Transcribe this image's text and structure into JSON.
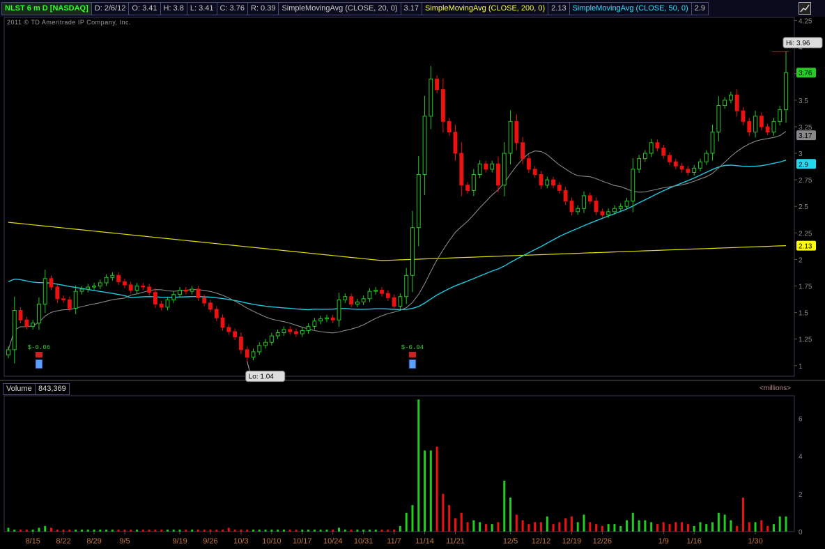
{
  "header": {
    "symbol": "NLST 6 m D [NASDAQ]",
    "date": "D: 2/6/12",
    "open": "O: 3.41",
    "high": "H: 3.8",
    "low": "L: 3.41",
    "close": "C: 3.76",
    "range": "R: 0.39",
    "sma20_label": "SimpleMovingAvg (CLOSE, 20, 0)",
    "sma20_value": "3.17",
    "sma200_label": "SimpleMovingAvg (CLOSE, 200, 0)",
    "sma200_value": "2.13",
    "sma50_label": "SimpleMovingAvg (CLOSE, 50, 0)",
    "sma50_value": "2.9"
  },
  "copyright": "2011 © TD Ameritrade IP Company, Inc.",
  "volume_panel": {
    "label": "Volume",
    "value": "843,369",
    "unit": "<millions>"
  },
  "colors": {
    "up": "#22cc22",
    "down": "#ee1111",
    "sma20": "#888888",
    "sma50": "#1ec8e0",
    "sma200": "#e0e000",
    "hiline": "#bb2222"
  },
  "chart_data": {
    "type": "candlestick",
    "price_axis": {
      "min": 0.9,
      "max": 4.28,
      "ticks": [
        1,
        1.25,
        1.5,
        1.75,
        2,
        2.25,
        2.5,
        2.75,
        3,
        3.25,
        3.5,
        3.75,
        4,
        4.25
      ]
    },
    "volume_axis": {
      "min": 0,
      "max": 7.2,
      "ticks": [
        0,
        2,
        4,
        6
      ]
    },
    "x_labels": [
      "8/15",
      "8/22",
      "8/29",
      "9/5",
      "9/19",
      "9/26",
      "10/3",
      "10/10",
      "10/17",
      "10/24",
      "10/31",
      "11/7",
      "11/14",
      "11/21",
      "12/5",
      "12/12",
      "12/19",
      "12/26",
      "1/9",
      "1/16",
      "1/30"
    ],
    "x_label_index": [
      4,
      9,
      14,
      19,
      28,
      33,
      38,
      43,
      48,
      53,
      58,
      63,
      68,
      73,
      82,
      87,
      92,
      97,
      107,
      112,
      122
    ],
    "hi_label": "Hi: 3.96",
    "lo_label": "Lo: 1.04",
    "hi_value": 3.96,
    "lo_value": 1.04,
    "events": [
      {
        "index": 5,
        "text": "$-0.06"
      },
      {
        "index": 66,
        "text": "$-0.04"
      }
    ],
    "price_tags": [
      {
        "value": 3.76,
        "text": "3.76"
      },
      {
        "value": 3.17,
        "text": "3.17"
      },
      {
        "value": 2.9,
        "text": "2.9"
      },
      {
        "value": 2.13,
        "text": "2.13"
      }
    ],
    "closes": [
      1.15,
      1.52,
      1.43,
      1.37,
      1.4,
      1.58,
      1.82,
      1.74,
      1.63,
      1.62,
      1.54,
      1.7,
      1.72,
      1.74,
      1.75,
      1.78,
      1.83,
      1.85,
      1.79,
      1.76,
      1.71,
      1.75,
      1.74,
      1.69,
      1.58,
      1.55,
      1.62,
      1.67,
      1.71,
      1.7,
      1.72,
      1.64,
      1.59,
      1.53,
      1.45,
      1.36,
      1.32,
      1.27,
      1.15,
      1.08,
      1.13,
      1.19,
      1.22,
      1.28,
      1.31,
      1.34,
      1.32,
      1.3,
      1.33,
      1.37,
      1.42,
      1.44,
      1.45,
      1.43,
      1.62,
      1.65,
      1.58,
      1.6,
      1.63,
      1.7,
      1.71,
      1.68,
      1.64,
      1.56,
      1.65,
      1.85,
      2.3,
      2.8,
      3.35,
      3.7,
      3.6,
      3.3,
      3.2,
      3.0,
      2.7,
      2.65,
      2.8,
      2.9,
      2.85,
      2.9,
      2.7,
      3.0,
      3.3,
      3.1,
      2.95,
      2.85,
      2.8,
      2.7,
      2.75,
      2.7,
      2.65,
      2.55,
      2.45,
      2.48,
      2.6,
      2.55,
      2.45,
      2.42,
      2.45,
      2.48,
      2.5,
      2.55,
      2.85,
      2.95,
      3.0,
      3.1,
      3.05,
      2.98,
      2.92,
      2.88,
      2.85,
      2.82,
      2.86,
      2.92,
      3.0,
      3.2,
      3.45,
      3.5,
      3.55,
      3.4,
      3.3,
      3.2,
      3.35,
      3.25,
      3.2,
      3.3,
      3.41,
      3.76
    ],
    "volumes": [
      0.2,
      0.1,
      0.1,
      0.1,
      0.1,
      0.2,
      0.3,
      0.2,
      0.1,
      0.1,
      0.1,
      0.1,
      0.1,
      0.1,
      0.1,
      0.1,
      0.1,
      0.1,
      0.1,
      0.1,
      0.1,
      0.1,
      0.1,
      0.1,
      0.1,
      0.1,
      0.1,
      0.1,
      0.1,
      0.1,
      0.1,
      0.1,
      0.1,
      0.1,
      0.1,
      0.1,
      0.2,
      0.1,
      0.1,
      0.1,
      0.1,
      0.1,
      0.1,
      0.1,
      0.1,
      0.1,
      0.1,
      0.1,
      0.1,
      0.1,
      0.1,
      0.1,
      0.1,
      0.1,
      0.2,
      0.1,
      0.1,
      0.1,
      0.1,
      0.1,
      0.1,
      0.1,
      0.1,
      0.1,
      0.3,
      1.0,
      1.4,
      7.0,
      4.3,
      4.3,
      4.5,
      2.0,
      1.4,
      0.7,
      1.0,
      0.5,
      0.6,
      0.5,
      0.4,
      0.4,
      0.5,
      2.7,
      1.8,
      0.9,
      0.6,
      0.4,
      0.5,
      0.5,
      0.8,
      0.4,
      0.5,
      0.7,
      0.8,
      0.5,
      0.9,
      0.5,
      0.4,
      0.3,
      0.4,
      0.4,
      0.3,
      0.6,
      1.0,
      0.6,
      0.6,
      0.5,
      0.4,
      0.5,
      0.4,
      0.5,
      0.5,
      0.4,
      0.3,
      0.5,
      0.4,
      0.5,
      1.0,
      0.9,
      0.6,
      0.3,
      1.8,
      0.5,
      0.5,
      0.6,
      0.3,
      0.4,
      0.8,
      0.8
    ]
  }
}
